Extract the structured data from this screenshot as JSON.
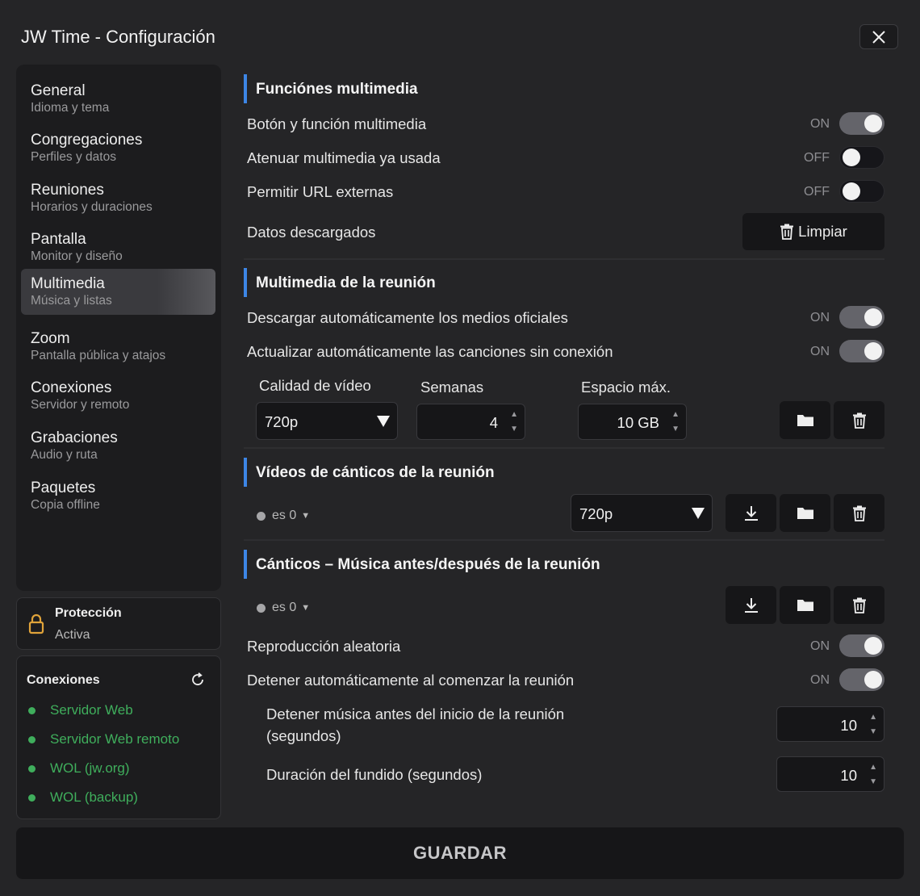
{
  "window": {
    "title": "JW Time - Configuración"
  },
  "sidebar": {
    "items": [
      {
        "label": "General",
        "sub": "Idioma y tema"
      },
      {
        "label": "Congregaciones",
        "sub": "Perfiles y datos"
      },
      {
        "label": "Reuniones",
        "sub": "Horarios y duraciones"
      },
      {
        "label": "Pantalla",
        "sub": "Monitor y diseño"
      },
      {
        "label": "Multimedia",
        "sub": "Música y listas"
      },
      {
        "label": "Zoom",
        "sub": "Pantalla pública y atajos"
      },
      {
        "label": "Conexiones",
        "sub": "Servidor y remoto"
      },
      {
        "label": "Grabaciones",
        "sub": "Audio y ruta"
      },
      {
        "label": "Paquetes",
        "sub": "Copia offline"
      }
    ],
    "active_index": 4
  },
  "protection": {
    "title": "Protección",
    "status": "Activa"
  },
  "connections": {
    "title": "Conexiones",
    "items": [
      "Servidor Web",
      "Servidor Web remoto",
      "WOL (jw.org)",
      "WOL (backup)"
    ],
    "status_color": "#3fae5c"
  },
  "sections": {
    "multimedia_functions": {
      "title": "Funciónes multimedia",
      "rows": [
        {
          "label": "Botón y función multimedia",
          "state": "ON"
        },
        {
          "label": "Atenuar multimedia ya usada",
          "state": "OFF"
        },
        {
          "label": "Permitir URL externas",
          "state": "OFF"
        }
      ],
      "downloaded_label": "Datos descargados",
      "clear_label": "Limpiar"
    },
    "meeting_media": {
      "title": "Multimedia de la reunión",
      "rows": [
        {
          "label": "Descargar automáticamente los medios oficiales",
          "state": "ON"
        },
        {
          "label": "Actualizar automáticamente las canciones sin conexión",
          "state": "ON"
        }
      ],
      "video_quality_label": "Calidad de vídeo",
      "video_quality_value": "720p",
      "weeks_label": "Semanas",
      "weeks_value": "4",
      "max_space_label": "Espacio máx.",
      "max_space_value": "10 GB"
    },
    "song_videos": {
      "title": "Vídeos de cánticos de la reunión",
      "lang": "es 0",
      "quality_value": "720p"
    },
    "songs_music": {
      "title": "Cánticos – Música antes/después de la reunión",
      "lang": "es 0",
      "rows": [
        {
          "label": "Reproducción aleatoria",
          "state": "ON"
        },
        {
          "label": "Detener automáticamente al comenzar la reunión",
          "state": "ON"
        }
      ],
      "stop_before_label_1": "Detener música antes del inicio de la reunión",
      "stop_before_label_2": "(segundos)",
      "stop_before_value": "10",
      "fade_label": "Duración del fundido (segundos)",
      "fade_value": "10"
    }
  },
  "footer": {
    "save_label": "GUARDAR"
  },
  "colors": {
    "accent": "#3d86e6",
    "background": "#252527",
    "panel": "#1c1c1e"
  }
}
